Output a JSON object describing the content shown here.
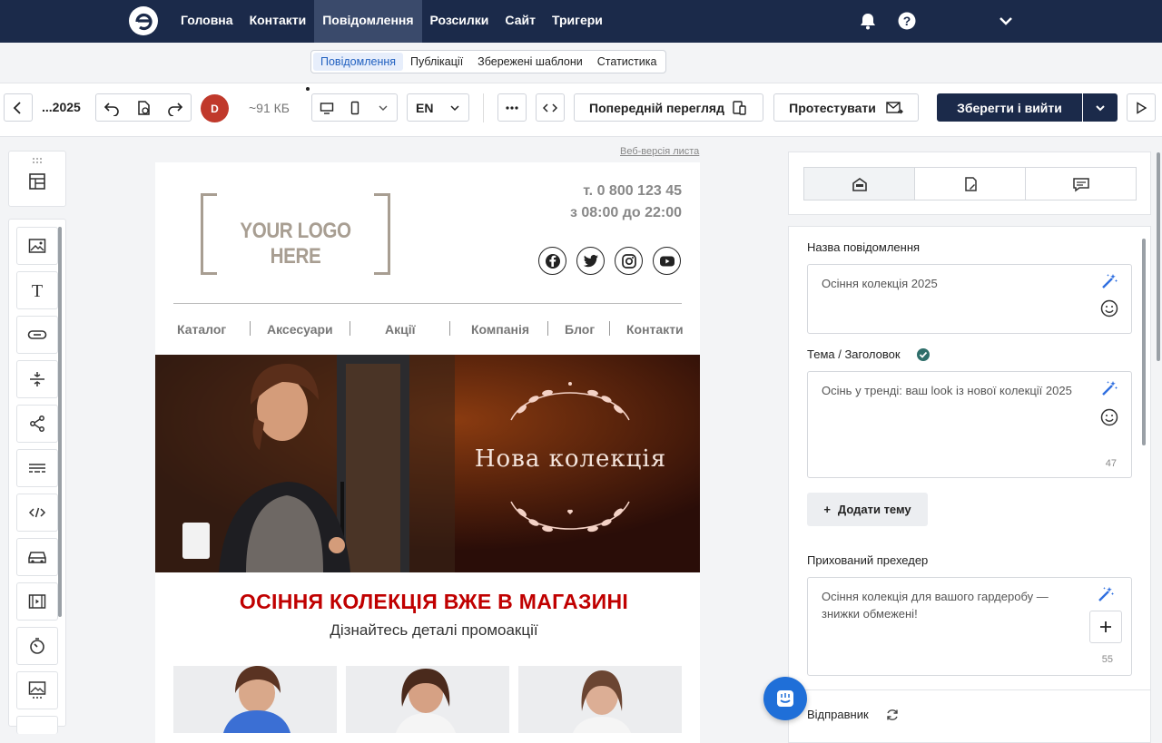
{
  "topnav": {
    "items": [
      {
        "label": "Головна"
      },
      {
        "label": "Контакти"
      },
      {
        "label": "Повідомлення",
        "active": true
      },
      {
        "label": "Розсилки"
      },
      {
        "label": "Сайт"
      },
      {
        "label": "Тригери"
      }
    ]
  },
  "subnav": {
    "tabs": [
      {
        "label": "Повідомлення",
        "active": true
      },
      {
        "label": "Публікації"
      },
      {
        "label": "Збережені шаблони"
      },
      {
        "label": "Статистика"
      }
    ]
  },
  "toolbar": {
    "doc_name": "...2025",
    "avatar_letter": "D",
    "size": "~91 КБ",
    "language": "EN",
    "preview_label": "Попередній перегляд",
    "test_label": "Протестувати",
    "save_label": "Зберегти і вийти"
  },
  "email": {
    "web_version": "Веб-версія листа",
    "logo_text": "YOUR LOGO HERE",
    "phone": "т. 0 800 123 45",
    "hours": "з 08:00 до 22:00",
    "nav": [
      "Каталог",
      "Аксесуари",
      "Акції",
      "Компанія",
      "Блог",
      "Контакти"
    ],
    "banner_text": "Нова колекція",
    "headline": "ОСІННЯ КОЛЕКЦІЯ ВЖЕ В МАГАЗИНІ",
    "subheadline": "Дізнайтесь деталі промоакції"
  },
  "settings": {
    "name_label": "Назва повідомлення",
    "name_value": "Осіння колекція 2025",
    "subject_label": "Тема / Заголовок",
    "subject_value": "Осінь у тренді: ваш look із нової колекції 2025",
    "subject_count": "47",
    "add_subject": "Додати тему",
    "preheader_label": "Прихований прехедер",
    "preheader_value": "Осіння колекція для вашого гардеробу — знижки обмежені!",
    "preheader_count": "55",
    "sender_label": "Відправник"
  },
  "colors": {
    "nav_bg": "#1b2a4a",
    "accent_red": "#c00000",
    "banner_bg": "#2a0d08"
  }
}
